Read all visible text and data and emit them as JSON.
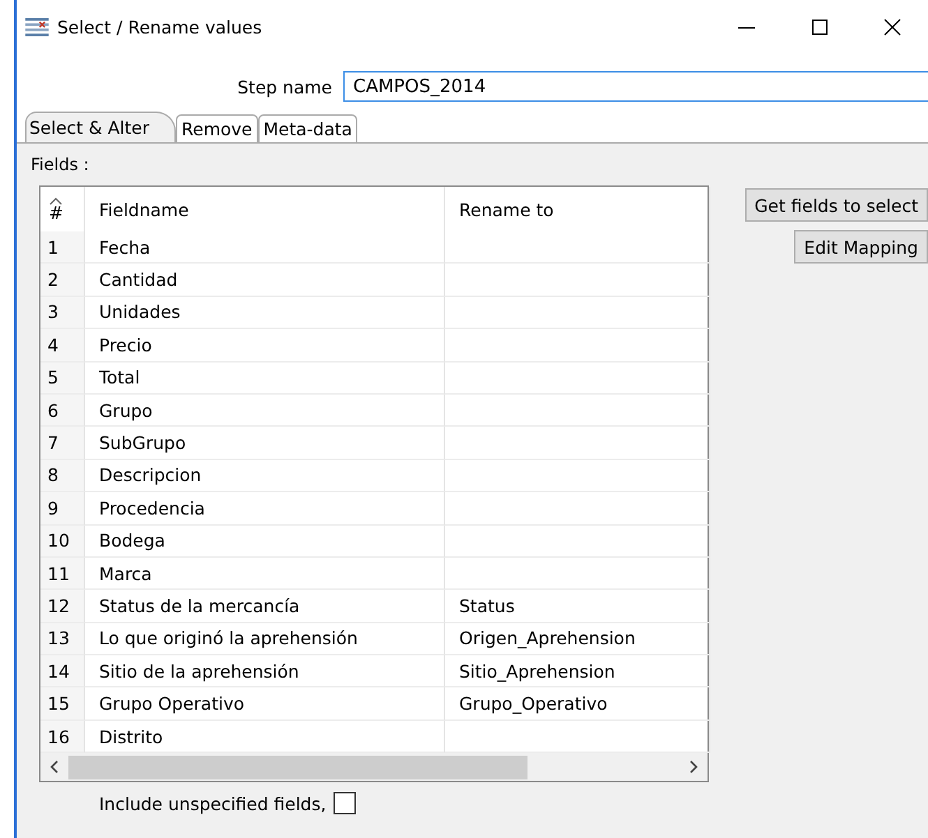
{
  "window": {
    "title": "Select / Rename values"
  },
  "step_name": {
    "label": "Step name",
    "value": "CAMPOS_2014"
  },
  "tabs": [
    {
      "label": "Select & Alter",
      "selected": true
    },
    {
      "label": "Remove",
      "selected": false
    },
    {
      "label": "Meta-data",
      "selected": false
    }
  ],
  "fields_label": "Fields :",
  "table": {
    "columns": [
      "#",
      "Fieldname",
      "Rename to"
    ],
    "rows": [
      [
        "1",
        "Fecha",
        ""
      ],
      [
        "2",
        "Cantidad",
        ""
      ],
      [
        "3",
        "Unidades",
        ""
      ],
      [
        "4",
        "Precio",
        ""
      ],
      [
        "5",
        "Total",
        ""
      ],
      [
        "6",
        "Grupo",
        ""
      ],
      [
        "7",
        "SubGrupo",
        ""
      ],
      [
        "8",
        "Descripcion",
        ""
      ],
      [
        "9",
        "Procedencia",
        ""
      ],
      [
        "10",
        "Bodega",
        ""
      ],
      [
        "11",
        "Marca",
        ""
      ],
      [
        "12",
        "Status de la mercancía",
        "Status"
      ],
      [
        "13",
        "Lo que originó la aprehensión",
        "Origen_Aprehension"
      ],
      [
        "14",
        "Sitio de la aprehensión",
        "Sitio_Aprehension"
      ],
      [
        "15",
        "Grupo Operativo",
        "Grupo_Operativo"
      ],
      [
        "16",
        "Distrito",
        ""
      ]
    ]
  },
  "buttons": [
    "Get fields to select",
    "Edit Mapping"
  ],
  "include_unspecified": {
    "label": "Include unspecified fields,",
    "checked": false
  }
}
